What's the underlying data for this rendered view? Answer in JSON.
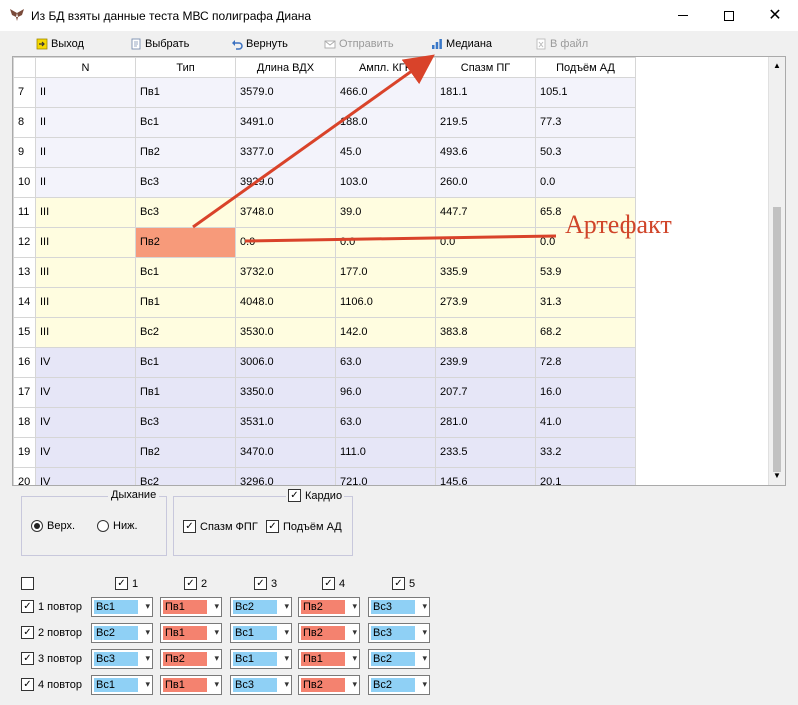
{
  "window": {
    "title": "Из БД взяты данные теста МВС полиграфа Диана",
    "min_symbol": "—",
    "close_symbol": "✕"
  },
  "toolbar": {
    "exit_label": "Выход",
    "select_label": "Выбрать",
    "back_label": "Вернуть",
    "send_label": "Отправить",
    "median_label": "Медиана",
    "to_file_label": "В файл"
  },
  "grid": {
    "headers": [
      "N",
      "Тип",
      "Длина ВДХ",
      "Ампл. КГР",
      "Спазм ПГ",
      "Подъём АД"
    ],
    "rows": [
      {
        "rn": "7",
        "n": "II",
        "t": "Пв1",
        "v": [
          "3579.0",
          "466.0",
          "181.1",
          "105.1"
        ]
      },
      {
        "rn": "8",
        "n": "II",
        "t": "Вс1",
        "v": [
          "3491.0",
          "188.0",
          "219.5",
          "77.3"
        ]
      },
      {
        "rn": "9",
        "n": "II",
        "t": "Пв2",
        "v": [
          "3377.0",
          "45.0",
          "493.6",
          "50.3"
        ]
      },
      {
        "rn": "10",
        "n": "II",
        "t": "Вс3",
        "v": [
          "3929.0",
          "103.0",
          "260.0",
          "0.0"
        ]
      },
      {
        "rn": "11",
        "n": "III",
        "t": "Вс3",
        "v": [
          "3748.0",
          "39.0",
          "447.7",
          "65.8"
        ]
      },
      {
        "rn": "12",
        "n": "III",
        "t": "Пв2",
        "v": [
          "0.0",
          "0.0",
          "0.0",
          "0.0"
        ]
      },
      {
        "rn": "13",
        "n": "III",
        "t": "Вс1",
        "v": [
          "3732.0",
          "177.0",
          "335.9",
          "53.9"
        ]
      },
      {
        "rn": "14",
        "n": "III",
        "t": "Пв1",
        "v": [
          "4048.0",
          "1106.0",
          "273.9",
          "31.3"
        ]
      },
      {
        "rn": "15",
        "n": "III",
        "t": "Вс2",
        "v": [
          "3530.0",
          "142.0",
          "383.8",
          "68.2"
        ]
      },
      {
        "rn": "16",
        "n": "IV",
        "t": "Вс1",
        "v": [
          "3006.0",
          "63.0",
          "239.9",
          "72.8"
        ]
      },
      {
        "rn": "17",
        "n": "IV",
        "t": "Пв1",
        "v": [
          "3350.0",
          "96.0",
          "207.7",
          "16.0"
        ]
      },
      {
        "rn": "18",
        "n": "IV",
        "t": "Вс3",
        "v": [
          "3531.0",
          "63.0",
          "281.0",
          "41.0"
        ]
      },
      {
        "rn": "19",
        "n": "IV",
        "t": "Пв2",
        "v": [
          "3470.0",
          "111.0",
          "233.5",
          "33.2"
        ]
      },
      {
        "rn": "20",
        "n": "IV",
        "t": "Вс2",
        "v": [
          "3296.0",
          "721.0",
          "145.6",
          "20.1"
        ]
      }
    ],
    "scroll_up": "▲",
    "scroll_down": "▼"
  },
  "breathing": {
    "title": "Дыхание",
    "upper_label": "Верх.",
    "lower_label": "Ниж.",
    "selected": "upper"
  },
  "cardio": {
    "title": "Кардио",
    "fpg_label": "Спазм ФПГ",
    "bp_label": "Подъём АД",
    "checkmark": "✓"
  },
  "matrix": {
    "columns": [
      "1",
      "2",
      "3",
      "4",
      "5"
    ],
    "rows": [
      {
        "label": "1 повтор",
        "cells": [
          "Вс1",
          "Пв1",
          "Вс2",
          "Пв2",
          "Вс3"
        ]
      },
      {
        "label": "2 повтор",
        "cells": [
          "Вс2",
          "Пв1",
          "Вс1",
          "Пв2",
          "Вс3"
        ]
      },
      {
        "label": "3 повтор",
        "cells": [
          "Вс3",
          "Пв2",
          "Вс1",
          "Пв1",
          "Вс2"
        ]
      },
      {
        "label": "4 повтор",
        "cells": [
          "Вс1",
          "Пв1",
          "Вс3",
          "Пв2",
          "Вс2"
        ]
      }
    ],
    "dropdown_symbol": "▾"
  },
  "annotation": {
    "label": "Артефакт",
    "color": "#d0452a"
  },
  "colors": {
    "vs_cell": "#8fd0f5",
    "pv_cell": "#f4826f",
    "artifact_cell": "#f79a7a"
  }
}
